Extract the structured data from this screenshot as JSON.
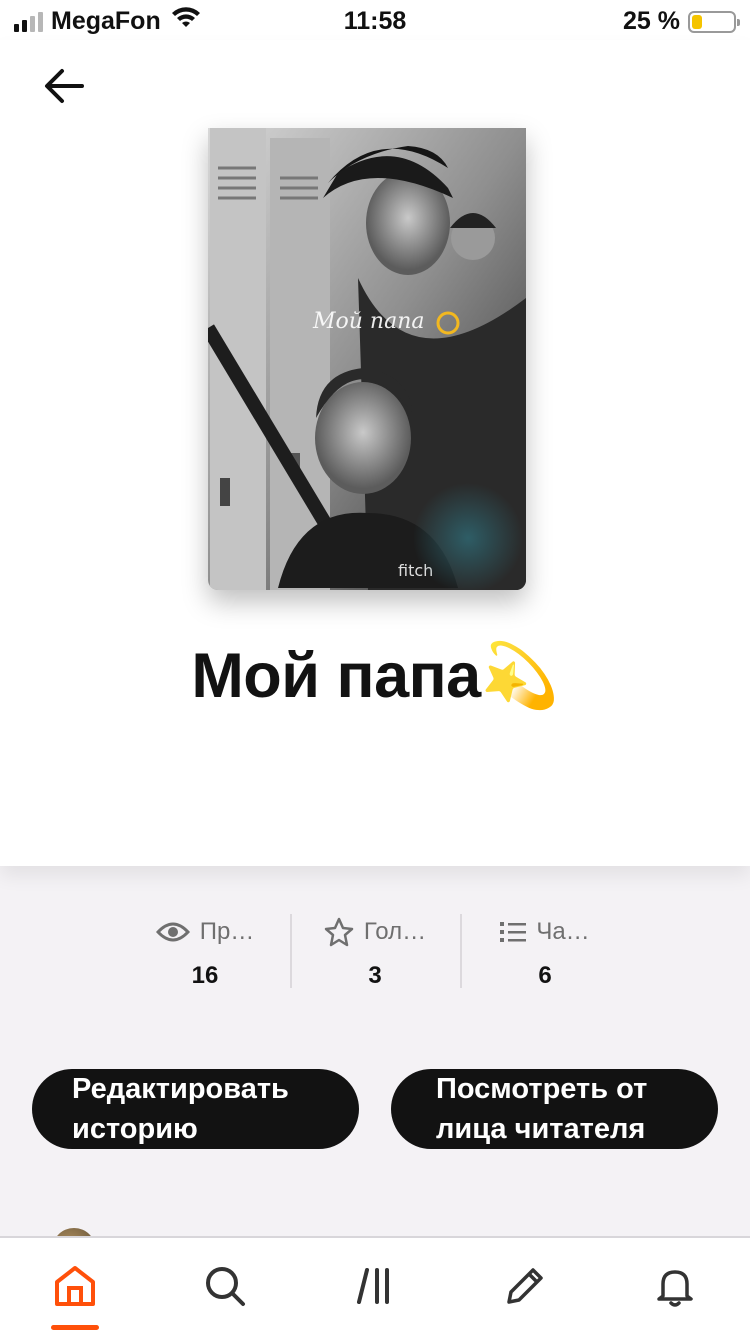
{
  "status_bar": {
    "carrier": "MegaFon",
    "time": "11:58",
    "battery_text": "25 %",
    "battery_level": 0.25,
    "battery_color": "#f5c400"
  },
  "header": {
    "back_icon": "arrow-left-icon"
  },
  "cover": {
    "overlay_text": "Мой папа"
  },
  "story": {
    "title": "Мой папа💫"
  },
  "stats": [
    {
      "icon": "eye-icon",
      "label": "Пр…",
      "value": "16"
    },
    {
      "icon": "star-icon",
      "label": "Гол…",
      "value": "3"
    },
    {
      "icon": "list-icon",
      "label": "Ча…",
      "value": "6"
    }
  ],
  "actions": {
    "edit_line1": "Редактировать",
    "edit_line2": "историю",
    "preview_line1": "Посмотреть от",
    "preview_line2": "лица читателя"
  },
  "bottom_nav": {
    "active_color": "#ff500a",
    "items": [
      "home-icon",
      "search-icon",
      "library-icon",
      "write-icon",
      "notifications-icon"
    ],
    "active_index": 0
  }
}
